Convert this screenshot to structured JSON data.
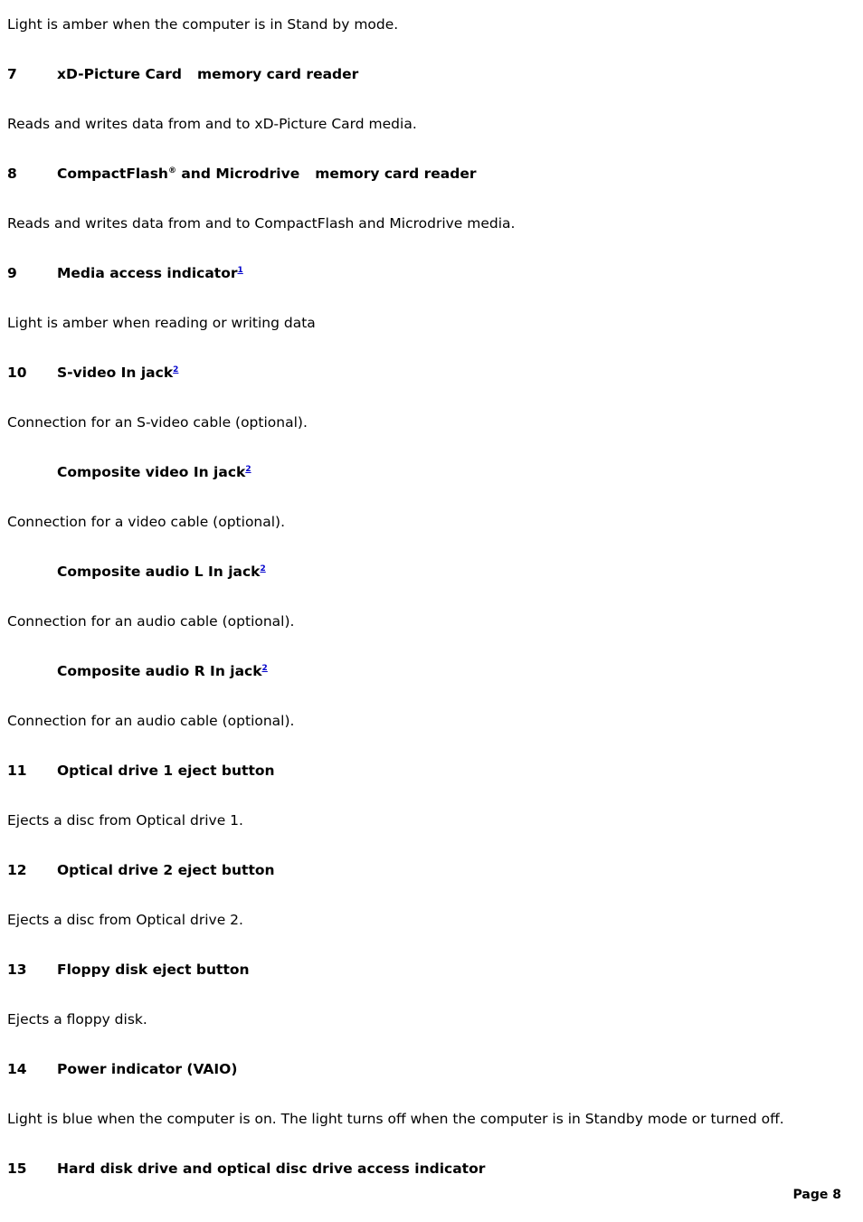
{
  "document": {
    "blocks": [
      {
        "kind": "para",
        "text": "Light is amber when the computer is in Stand by mode."
      },
      {
        "kind": "heading",
        "number": "7",
        "title": "xD-Picture Card",
        "title_tail": "memory card reader",
        "trademark_gap": true
      },
      {
        "kind": "para",
        "text": "Reads and writes data from and to xD-Picture Card media."
      },
      {
        "kind": "heading",
        "number": "8",
        "title": "CompactFlash",
        "registered": "®",
        "title_mid": " and Microdrive",
        "title_tail": "memory card reader",
        "trademark_gap": true
      },
      {
        "kind": "para",
        "text": "Reads and writes data from and to CompactFlash and Microdrive media."
      },
      {
        "kind": "heading",
        "number": "9",
        "title": "Media access indicator",
        "footnote": "1"
      },
      {
        "kind": "para",
        "text": "Light is amber when reading or writing data"
      },
      {
        "kind": "heading",
        "number": "10",
        "title": "S-video In jack",
        "footnote": "2"
      },
      {
        "kind": "para",
        "text": "Connection for an S-video cable (optional)."
      },
      {
        "kind": "heading",
        "number": "",
        "title": "Composite video In jack",
        "footnote": "2"
      },
      {
        "kind": "para",
        "text": "Connection for a video cable (optional)."
      },
      {
        "kind": "heading",
        "number": "",
        "title": "Composite audio L In jack",
        "footnote": "2"
      },
      {
        "kind": "para",
        "text": "Connection for an audio cable (optional)."
      },
      {
        "kind": "heading",
        "number": "",
        "title": "Composite audio R In jack",
        "footnote": "2"
      },
      {
        "kind": "para",
        "text": "Connection for an audio cable (optional)."
      },
      {
        "kind": "heading",
        "number": "11",
        "title": "Optical drive 1 eject button"
      },
      {
        "kind": "para",
        "text": "Ejects a disc from Optical drive 1."
      },
      {
        "kind": "heading",
        "number": "12",
        "title": "Optical drive 2 eject button"
      },
      {
        "kind": "para",
        "text": "Ejects a disc from Optical drive 2."
      },
      {
        "kind": "heading",
        "number": "13",
        "title": "Floppy disk eject button"
      },
      {
        "kind": "para",
        "text": "Ejects a floppy disk."
      },
      {
        "kind": "heading",
        "number": "14",
        "title": "Power indicator (VAIO)"
      },
      {
        "kind": "para",
        "text": "Light is blue when the computer is on. The light turns off when the computer is in Standby mode or turned off."
      },
      {
        "kind": "heading",
        "number": "15",
        "title": "Hard disk drive and optical disc drive access indicator"
      }
    ]
  },
  "footer": {
    "page_label": "Page 8"
  },
  "colors": {
    "text": "#000000",
    "link": "#0000cc",
    "background": "#ffffff"
  }
}
